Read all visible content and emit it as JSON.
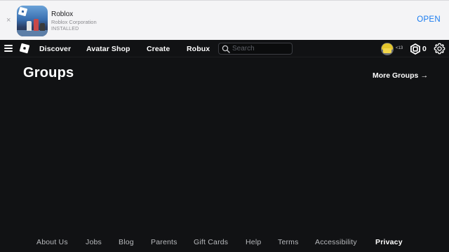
{
  "banner": {
    "close_glyph": "×",
    "app_name": "Roblox",
    "company": "Roblox Corporation",
    "status": "INSTALLED",
    "open_label": "OPEN"
  },
  "nav": {
    "links": [
      "Discover",
      "Avatar Shop",
      "Create",
      "Robux"
    ],
    "search_placeholder": "Search",
    "age_badge": "<13",
    "robux_count": "0",
    "icons": [
      "menu-icon",
      "roblox-logo",
      "search-icon",
      "avatar",
      "robux-icon",
      "gear-icon"
    ]
  },
  "main": {
    "title": "Groups",
    "more_groups_label": "More Groups",
    "more_groups_arrow": "→"
  },
  "footer": {
    "links": [
      "About Us",
      "Jobs",
      "Blog",
      "Parents",
      "Gift Cards",
      "Help",
      "Terms",
      "Accessibility",
      "Privacy"
    ]
  },
  "colors": {
    "background": "#111214",
    "banner_background": "#f4f4f6",
    "open_button": "#1a7cf0",
    "text": "#ffffff",
    "footer_text": "#b8babd"
  }
}
